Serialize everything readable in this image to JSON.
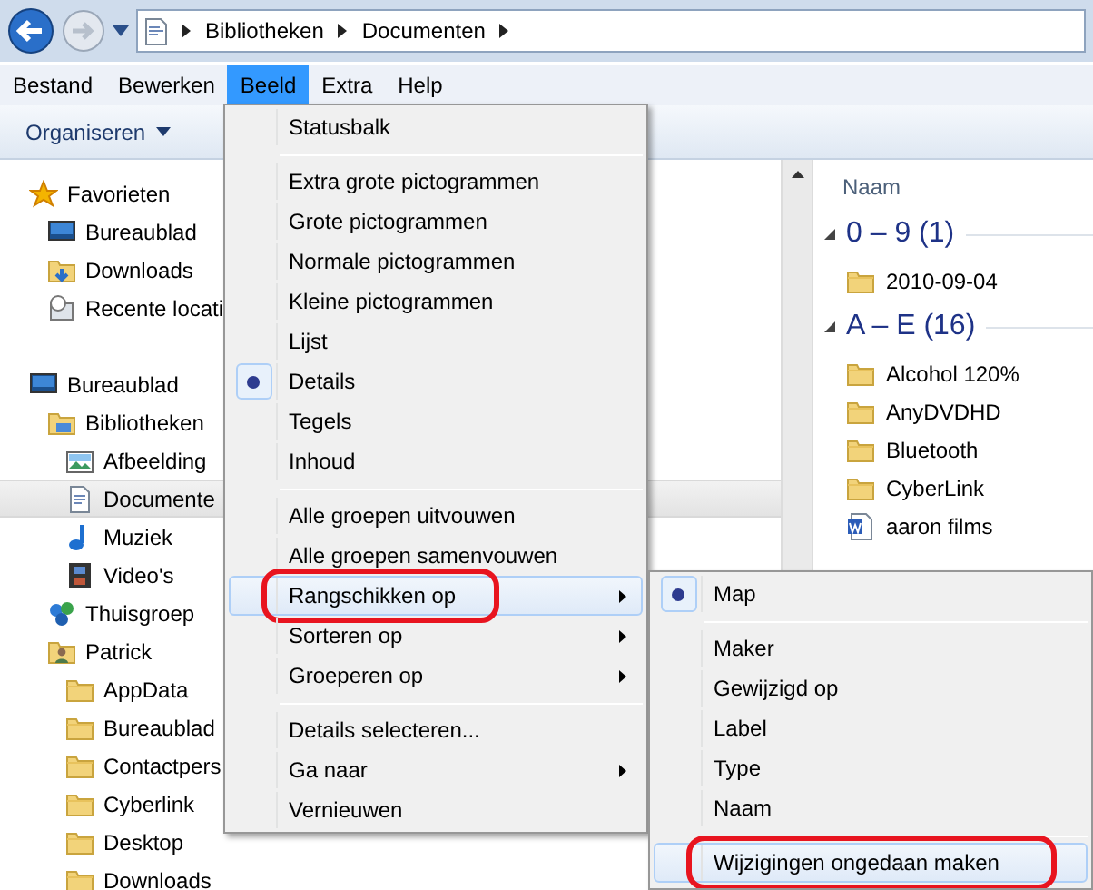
{
  "address_bar": {
    "crumbs": [
      "Bibliotheken",
      "Documenten"
    ]
  },
  "menu_bar": [
    {
      "label": "Bestand",
      "selected": false
    },
    {
      "label": "Bewerken",
      "selected": false
    },
    {
      "label": "Beeld",
      "selected": true
    },
    {
      "label": "Extra",
      "selected": false
    },
    {
      "label": "Help",
      "selected": false
    }
  ],
  "toolbar": {
    "organize": "Organiseren"
  },
  "navigation_tree": [
    {
      "label": "Favorieten",
      "kind": "star",
      "selected": false,
      "children": [
        {
          "label": "Bureaublad",
          "kind": "desktop",
          "selected": false
        },
        {
          "label": "Downloads",
          "kind": "download",
          "selected": false
        },
        {
          "label": "Recente locati",
          "kind": "recent",
          "selected": false
        }
      ]
    },
    {
      "label": "Bureaublad",
      "kind": "desktop",
      "selected": false,
      "children": [
        {
          "label": "Bibliotheken",
          "kind": "library",
          "selected": false,
          "children": [
            {
              "label": "Afbeelding",
              "kind": "image",
              "selected": false
            },
            {
              "label": "Documente",
              "kind": "document",
              "selected": true
            },
            {
              "label": "Muziek",
              "kind": "music",
              "selected": false
            },
            {
              "label": "Video's",
              "kind": "video",
              "selected": false
            }
          ]
        },
        {
          "label": "Thuisgroep",
          "kind": "group",
          "selected": false
        },
        {
          "label": "Patrick",
          "kind": "user",
          "selected": false,
          "children": [
            {
              "label": "AppData",
              "kind": "folder",
              "selected": false
            },
            {
              "label": "Bureaublad",
              "kind": "folder",
              "selected": false
            },
            {
              "label": "Contactpers",
              "kind": "folder",
              "selected": false
            },
            {
              "label": "Cyberlink",
              "kind": "folder",
              "selected": false
            },
            {
              "label": "Desktop",
              "kind": "folder",
              "selected": false
            },
            {
              "label": "Downloads",
              "kind": "folder",
              "selected": false
            }
          ]
        }
      ]
    }
  ],
  "file_list": {
    "column": "Naam",
    "groups": [
      {
        "title": "0 – 9 (1)",
        "items": [
          {
            "name": "2010-09-04",
            "kind": "folder"
          }
        ]
      },
      {
        "title": "A – E (16)",
        "items": [
          {
            "name": "Alcohol 120%",
            "kind": "folder"
          },
          {
            "name": "AnyDVDHD",
            "kind": "folder"
          },
          {
            "name": "Bluetooth",
            "kind": "folder"
          },
          {
            "name": "CyberLink",
            "kind": "folder"
          },
          {
            "name": "aaron films",
            "kind": "word"
          }
        ]
      }
    ]
  },
  "view_menu": {
    "items": [
      {
        "kind": "item",
        "label": "Statusbalk",
        "checked": false,
        "highlighted": false,
        "circled": false
      },
      {
        "kind": "separator"
      },
      {
        "kind": "item",
        "label": "Extra grote pictogrammen",
        "checked": false,
        "highlighted": false,
        "circled": false
      },
      {
        "kind": "item",
        "label": "Grote pictogrammen",
        "checked": false,
        "highlighted": false,
        "circled": false
      },
      {
        "kind": "item",
        "label": "Normale pictogrammen",
        "checked": false,
        "highlighted": false,
        "circled": false
      },
      {
        "kind": "item",
        "label": "Kleine pictogrammen",
        "checked": false,
        "highlighted": false,
        "circled": false
      },
      {
        "kind": "item",
        "label": "Lijst",
        "checked": false,
        "highlighted": false,
        "circled": false
      },
      {
        "kind": "item",
        "label": "Details",
        "checked": true,
        "highlighted": false,
        "circled": false
      },
      {
        "kind": "item",
        "label": "Tegels",
        "checked": false,
        "highlighted": false,
        "circled": false
      },
      {
        "kind": "item",
        "label": "Inhoud",
        "checked": false,
        "highlighted": false,
        "circled": false
      },
      {
        "kind": "separator"
      },
      {
        "kind": "item",
        "label": "Alle groepen uitvouwen",
        "checked": false,
        "highlighted": false,
        "circled": false
      },
      {
        "kind": "item",
        "label": "Alle groepen samenvouwen",
        "checked": false,
        "highlighted": false,
        "circled": false
      },
      {
        "kind": "submenu",
        "label": "Rangschikken op",
        "checked": false,
        "highlighted": true,
        "circled": true
      },
      {
        "kind": "submenu",
        "label": "Sorteren op",
        "checked": false,
        "highlighted": false,
        "circled": false
      },
      {
        "kind": "submenu",
        "label": "Groeperen op",
        "checked": false,
        "highlighted": false,
        "circled": false
      },
      {
        "kind": "separator"
      },
      {
        "kind": "item",
        "label": "Details selecteren...",
        "checked": false,
        "highlighted": false,
        "circled": false
      },
      {
        "kind": "submenu",
        "label": "Ga naar",
        "checked": false,
        "highlighted": false,
        "circled": false
      },
      {
        "kind": "item",
        "label": "Vernieuwen",
        "checked": false,
        "highlighted": false,
        "circled": false
      }
    ]
  },
  "arrange_submenu": {
    "items": [
      {
        "kind": "item",
        "label": "Map",
        "checked": true,
        "highlighted": false,
        "circled": false
      },
      {
        "kind": "separator"
      },
      {
        "kind": "item",
        "label": "Maker",
        "checked": false,
        "highlighted": false,
        "circled": false
      },
      {
        "kind": "item",
        "label": "Gewijzigd op",
        "checked": false,
        "highlighted": false,
        "circled": false
      },
      {
        "kind": "item",
        "label": "Label",
        "checked": false,
        "highlighted": false,
        "circled": false
      },
      {
        "kind": "item",
        "label": "Type",
        "checked": false,
        "highlighted": false,
        "circled": false
      },
      {
        "kind": "item",
        "label": "Naam",
        "checked": false,
        "highlighted": false,
        "circled": false
      },
      {
        "kind": "separator"
      },
      {
        "kind": "item",
        "label": "Wijzigingen ongedaan maken",
        "checked": false,
        "highlighted": true,
        "circled": true
      }
    ]
  }
}
